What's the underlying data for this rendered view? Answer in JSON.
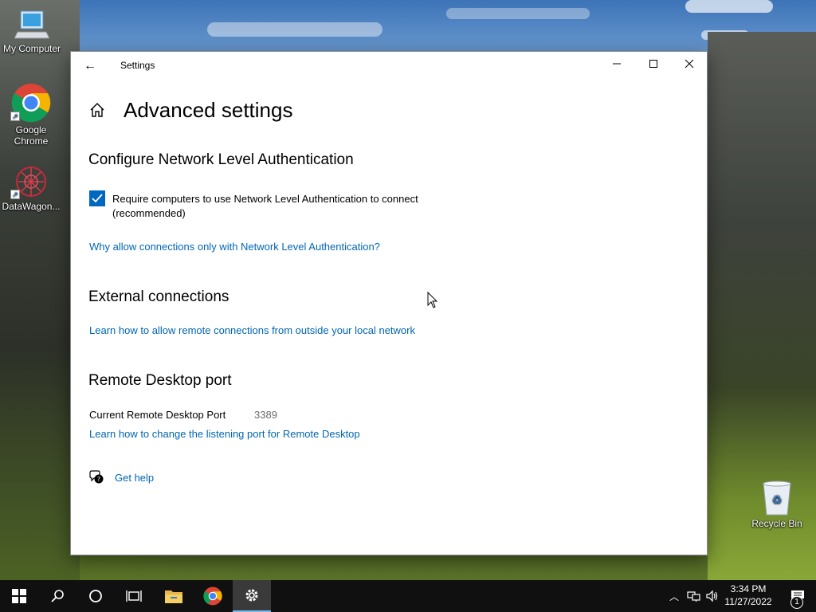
{
  "desktop": {
    "icons": [
      {
        "label": "My Computer"
      },
      {
        "label": "Google Chrome"
      },
      {
        "label": "DataWagon..."
      },
      {
        "label": "Recycle Bin"
      }
    ]
  },
  "window": {
    "title": "Settings",
    "controls": {
      "minimize": "minimize-icon",
      "maximize": "maximize-icon",
      "close": "close-icon"
    },
    "page_title": "Advanced settings",
    "sections": {
      "nla": {
        "title": "Configure Network Level Authentication",
        "checkbox_label": "Require computers to use Network Level Authentication to connect (recommended)",
        "checkbox_checked": true,
        "link": "Why allow connections only with Network Level Authentication?"
      },
      "external": {
        "title": "External connections",
        "link": "Learn how to allow remote connections from outside your local network"
      },
      "port": {
        "title": "Remote Desktop port",
        "label": "Current Remote Desktop Port",
        "value": "3389",
        "link": "Learn how to change the listening port for Remote Desktop"
      }
    },
    "help": {
      "label": "Get help"
    }
  },
  "taskbar": {
    "items": [
      "windows-start-icon",
      "search-icon",
      "cortana-icon",
      "task-view-icon",
      "file-explorer-icon",
      "chrome-icon",
      "settings-icon"
    ],
    "active": "settings-icon",
    "clock": {
      "time": "3:34 PM",
      "date": "11/27/2022"
    },
    "notifications_count": "1"
  },
  "colors": {
    "accent": "#0067c0",
    "link": "#0066b4",
    "taskbar": "#101010"
  }
}
